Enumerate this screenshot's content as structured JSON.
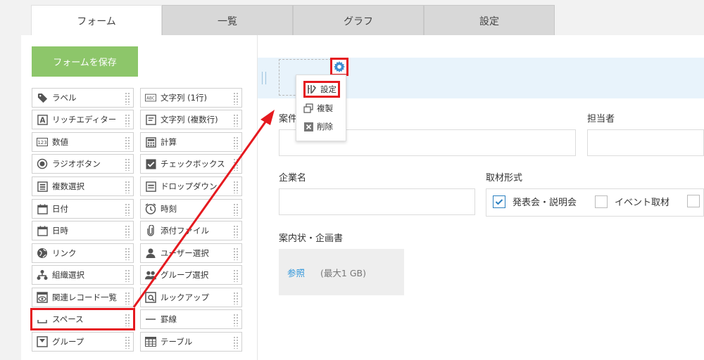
{
  "tabs": [
    {
      "label": "フォーム"
    },
    {
      "label": "一覧"
    },
    {
      "label": "グラフ"
    },
    {
      "label": "設定"
    }
  ],
  "palette": {
    "save_label": "フォームを保存",
    "fields": [
      {
        "label": "ラベル",
        "icon": "tag-icon"
      },
      {
        "label": "文字列 (1行)",
        "icon": "abc-icon"
      },
      {
        "label": "リッチエディター",
        "icon": "rich-editor-icon"
      },
      {
        "label": "文字列 (複数行)",
        "icon": "multiline-icon"
      },
      {
        "label": "数値",
        "icon": "number-icon"
      },
      {
        "label": "計算",
        "icon": "calculator-icon"
      },
      {
        "label": "ラジオボタン",
        "icon": "radio-icon"
      },
      {
        "label": "チェックボックス",
        "icon": "checkbox-icon"
      },
      {
        "label": "複数選択",
        "icon": "multi-select-icon"
      },
      {
        "label": "ドロップダウン",
        "icon": "dropdown-icon"
      },
      {
        "label": "日付",
        "icon": "calendar-icon"
      },
      {
        "label": "時刻",
        "icon": "clock-icon"
      },
      {
        "label": "日時",
        "icon": "datetime-icon"
      },
      {
        "label": "添付ファイル",
        "icon": "paperclip-icon"
      },
      {
        "label": "リンク",
        "icon": "globe-icon"
      },
      {
        "label": "ユーザー選択",
        "icon": "user-icon"
      },
      {
        "label": "組織選択",
        "icon": "org-icon"
      },
      {
        "label": "グループ選択",
        "icon": "group-icon"
      },
      {
        "label": "関連レコード一覧",
        "icon": "related-records-icon"
      },
      {
        "label": "ルックアップ",
        "icon": "lookup-icon"
      },
      {
        "label": "スペース",
        "icon": "space-icon"
      },
      {
        "label": "罫線",
        "icon": "line-icon"
      },
      {
        "label": "グループ",
        "icon": "group-frame-icon"
      },
      {
        "label": "テーブル",
        "icon": "table-icon"
      }
    ]
  },
  "menu": {
    "items": [
      {
        "label": "設定",
        "icon": "settings-icon"
      },
      {
        "label": "複製",
        "icon": "duplicate-icon"
      },
      {
        "label": "削除",
        "icon": "delete-icon"
      }
    ]
  },
  "form": {
    "case_label": "案件",
    "assignee_label": "担当者",
    "company_label": "企業名",
    "format_label": "取材形式",
    "format_options": [
      {
        "label": "発表会・説明会",
        "checked": true
      },
      {
        "label": "イベント取材",
        "checked": false
      }
    ],
    "attachment_label": "案内状・企画書",
    "browse_label": "参照",
    "size_limit": "(最大1 GB)"
  },
  "colors": {
    "save_button": "#8dc66a",
    "highlight": "#e5191f",
    "selected_row": "#e8f3fb",
    "link": "#3498db",
    "checkbox_check": "#2a7fc0"
  }
}
